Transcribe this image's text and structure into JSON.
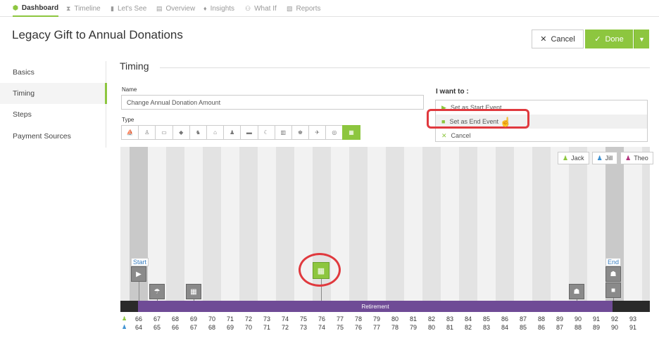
{
  "nav": {
    "items": [
      {
        "label": "Dashboard",
        "icon": "dashboard-icon",
        "active": true
      },
      {
        "label": "Timeline",
        "icon": "hourglass-icon"
      },
      {
        "label": "Let's See",
        "icon": "bar-chart-icon"
      },
      {
        "label": "Overview",
        "icon": "document-icon"
      },
      {
        "label": "Insights",
        "icon": "lightbulb-icon"
      },
      {
        "label": "What If",
        "icon": "users-icon"
      },
      {
        "label": "Reports",
        "icon": "report-icon"
      }
    ]
  },
  "header": {
    "title": "Legacy Gift to Annual Donations",
    "cancel_label": "Cancel",
    "done_label": "Done"
  },
  "leftmenu": {
    "items": [
      "Basics",
      "Timing",
      "Steps",
      "Payment Sources"
    ],
    "active": "Timing"
  },
  "timing": {
    "section_title": "Timing",
    "name_label": "Name",
    "name_value": "Change Annual Donation Amount",
    "type_label": "Type",
    "type_count": 13,
    "type_selected": "calendar-icon"
  },
  "iwant": {
    "label": "I want to :",
    "actions": [
      {
        "label": "Set as Start Event",
        "icon": "play-icon",
        "color": "#8dc63f"
      },
      {
        "label": "Set as End Event",
        "icon": "stop-icon",
        "color": "#8dc63f"
      },
      {
        "label": "Cancel",
        "icon": "close-icon",
        "color": "#8dc63f"
      }
    ]
  },
  "timeline": {
    "people": [
      {
        "name": "Jack",
        "color": "#8dc63f"
      },
      {
        "name": "Jill",
        "color": "#3a8fd1"
      },
      {
        "name": "Theo",
        "color": "#b0307a"
      }
    ],
    "start_label": "Start",
    "end_label": "End",
    "retirement_label": "Retirement",
    "ages_jack": [
      "66",
      "67",
      "68",
      "69",
      "70",
      "71",
      "72",
      "73",
      "74",
      "75",
      "76",
      "77",
      "78",
      "79",
      "80",
      "81",
      "82",
      "83",
      "84",
      "85",
      "86",
      "87",
      "88",
      "89",
      "90",
      "91",
      "92",
      "93"
    ],
    "ages_jill": [
      "64",
      "65",
      "66",
      "67",
      "68",
      "69",
      "70",
      "71",
      "72",
      "73",
      "74",
      "75",
      "76",
      "77",
      "78",
      "79",
      "80",
      "81",
      "82",
      "83",
      "84",
      "85",
      "86",
      "87",
      "88",
      "89",
      "90",
      "91"
    ]
  }
}
